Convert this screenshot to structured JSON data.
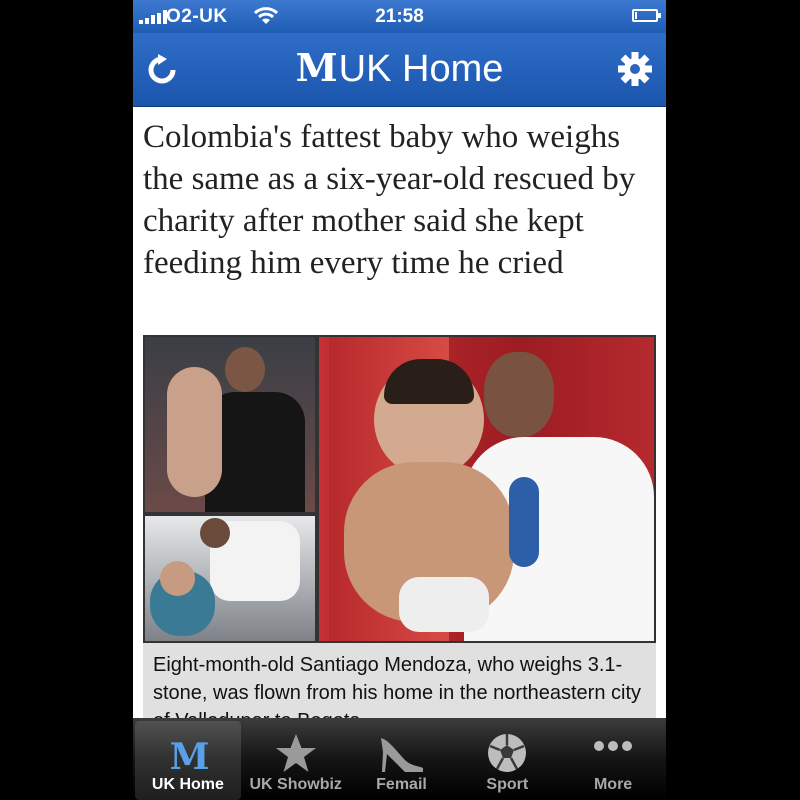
{
  "status_bar": {
    "carrier": "O2-UK",
    "time": "21:58",
    "battery_level": 0.1
  },
  "nav_bar": {
    "logo_text": "M",
    "title": "UK Home"
  },
  "article": {
    "headline": "Colombia's fattest baby who weighs the same as a six-year-old rescued by charity after mother said she kept feeding him every time he cried",
    "caption": "Eight-month-old Santiago Mendoza, who weighs 3.1-stone, was flown from his home in the northeastern city of Valledupar to Bogota"
  },
  "tab_bar": {
    "tabs": [
      {
        "label": "UK Home",
        "icon": "dailymail-logo-icon",
        "active": true
      },
      {
        "label": "UK Showbiz",
        "icon": "star-icon",
        "active": false
      },
      {
        "label": "Femail",
        "icon": "high-heel-icon",
        "active": false
      },
      {
        "label": "Sport",
        "icon": "football-icon",
        "active": false
      },
      {
        "label": "More",
        "icon": "ellipsis-icon",
        "active": false
      }
    ]
  },
  "colors": {
    "nav_blue": "#1f5cb4",
    "tab_bar": "#151515",
    "caption_bg": "#e0e0e0"
  }
}
